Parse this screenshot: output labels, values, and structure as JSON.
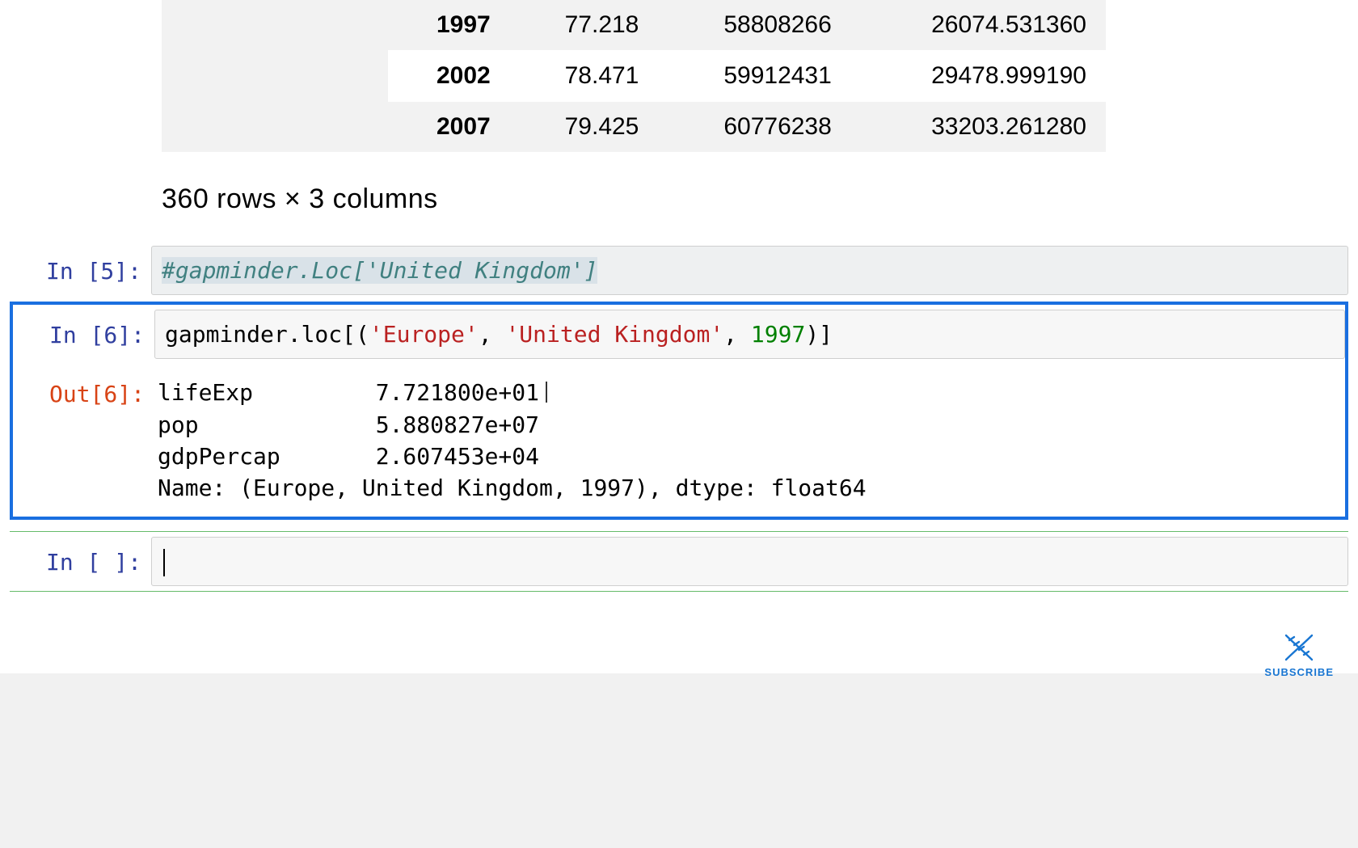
{
  "dataframe_tail": {
    "rows": [
      {
        "year": "1997",
        "lifeExp": "77.218",
        "pop": "58808266",
        "gdpPercap": "26074.531360"
      },
      {
        "year": "2002",
        "lifeExp": "78.471",
        "pop": "59912431",
        "gdpPercap": "29478.999190"
      },
      {
        "year": "2007",
        "lifeExp": "79.425",
        "pop": "60776238",
        "gdpPercap": "33203.261280"
      }
    ],
    "summary": "360 rows × 3 columns"
  },
  "cells": {
    "in5": {
      "prompt": "In [5]:",
      "code_comment": "#gapminder.Loc['United Kingdom']"
    },
    "in6": {
      "prompt": "In [6]:",
      "code": {
        "p1": "gapminder.loc[(",
        "s1": "'Europe'",
        "c1": ", ",
        "s2": "'United Kingdom'",
        "c2": ", ",
        "n1": "1997",
        "p2": ")]"
      }
    },
    "out6": {
      "prompt": "Out[6]:",
      "lines": {
        "l1": "lifeExp         7.721800e+01",
        "l2": "pop             5.880827e+07",
        "l3": "gdpPercap       2.607453e+04",
        "l4": "Name: (Europe, United Kingdom, 1997), dtype: float64"
      }
    },
    "in_empty": {
      "prompt": "In [ ]:"
    }
  },
  "subscribe": {
    "label": "SUBSCRIBE"
  }
}
